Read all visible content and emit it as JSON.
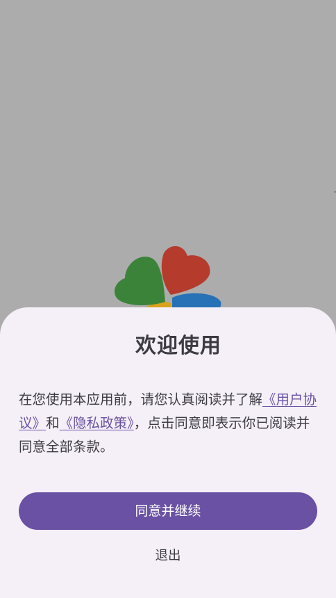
{
  "dialog": {
    "title": "欢迎使用",
    "text_before": "在您使用本应用前，请您认真阅读并了解",
    "user_agreement_link": "《用户协议》",
    "text_and": "和",
    "privacy_policy_link": "《隐私政策》",
    "text_after": "，点击同意即表示你已阅读并同意全部条款。",
    "agree_button": "同意并继续",
    "exit_button": "退出"
  },
  "colors": {
    "overlay": "#acacac",
    "sheet_background": "#f5f0f8",
    "accent": "#6a51a4",
    "link": "#6a52a3",
    "logo_green": "#3a8339",
    "logo_red": "#b53b2c",
    "logo_blue": "#2771b6",
    "logo_yellow": "#d9a21b"
  },
  "logo": {
    "icon": "four-leaf-heart-clover-logo"
  }
}
